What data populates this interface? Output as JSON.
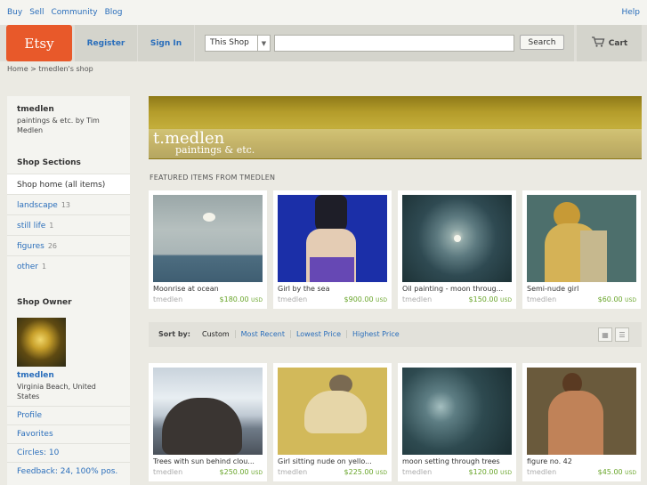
{
  "topnav": {
    "links": [
      "Buy",
      "Sell",
      "Community",
      "Blog"
    ],
    "help": "Help"
  },
  "header": {
    "logo": "Etsy",
    "register": "Register",
    "signin": "Sign In",
    "search_scope": "This Shop",
    "search_button": "Search",
    "cart": "Cart"
  },
  "breadcrumb": "Home > tmedlen's shop",
  "sidebar": {
    "shop_name": "tmedlen",
    "shop_desc": "paintings & etc. by Tim Medlen",
    "sections_title": "Shop Sections",
    "sections": [
      {
        "label": "Shop home (all items)",
        "count": ""
      },
      {
        "label": "landscape",
        "count": "13"
      },
      {
        "label": "still life",
        "count": "1"
      },
      {
        "label": "figures",
        "count": "26"
      },
      {
        "label": "other",
        "count": "1"
      }
    ],
    "owner_title": "Shop Owner",
    "owner_name": "tmedlen",
    "owner_location": "Virginia Beach, United States",
    "owner_links": [
      "Profile",
      "Favorites",
      "Circles: 10",
      "Feedback: 24, 100% pos."
    ]
  },
  "banner": {
    "line1": "t.medlen",
    "line2": "paintings & etc."
  },
  "featured_title": "FEATURED ITEMS FROM TMEDLEN",
  "featured": [
    {
      "title": "Moonrise at ocean",
      "seller": "tmedlen",
      "price": "$180.00",
      "currency": "USD"
    },
    {
      "title": "Girl by the sea",
      "seller": "tmedlen",
      "price": "$900.00",
      "currency": "USD"
    },
    {
      "title": "Oil painting - moon throug...",
      "seller": "tmedlen",
      "price": "$150.00",
      "currency": "USD"
    },
    {
      "title": "Semi-nude girl",
      "seller": "tmedlen",
      "price": "$60.00",
      "currency": "USD"
    }
  ],
  "sort": {
    "label": "Sort by:",
    "options": [
      "Custom",
      "Most Recent",
      "Lowest Price",
      "Highest Price"
    ]
  },
  "listings": [
    {
      "title": "Trees with sun behind clou...",
      "seller": "tmedlen",
      "price": "$250.00",
      "currency": "USD"
    },
    {
      "title": "Girl sitting nude on yello...",
      "seller": "tmedlen",
      "price": "$225.00",
      "currency": "USD"
    },
    {
      "title": "moon setting through trees",
      "seller": "tmedlen",
      "price": "$120.00",
      "currency": "USD"
    },
    {
      "title": "figure no. 42",
      "seller": "tmedlen",
      "price": "$45.00",
      "currency": "USD"
    }
  ]
}
